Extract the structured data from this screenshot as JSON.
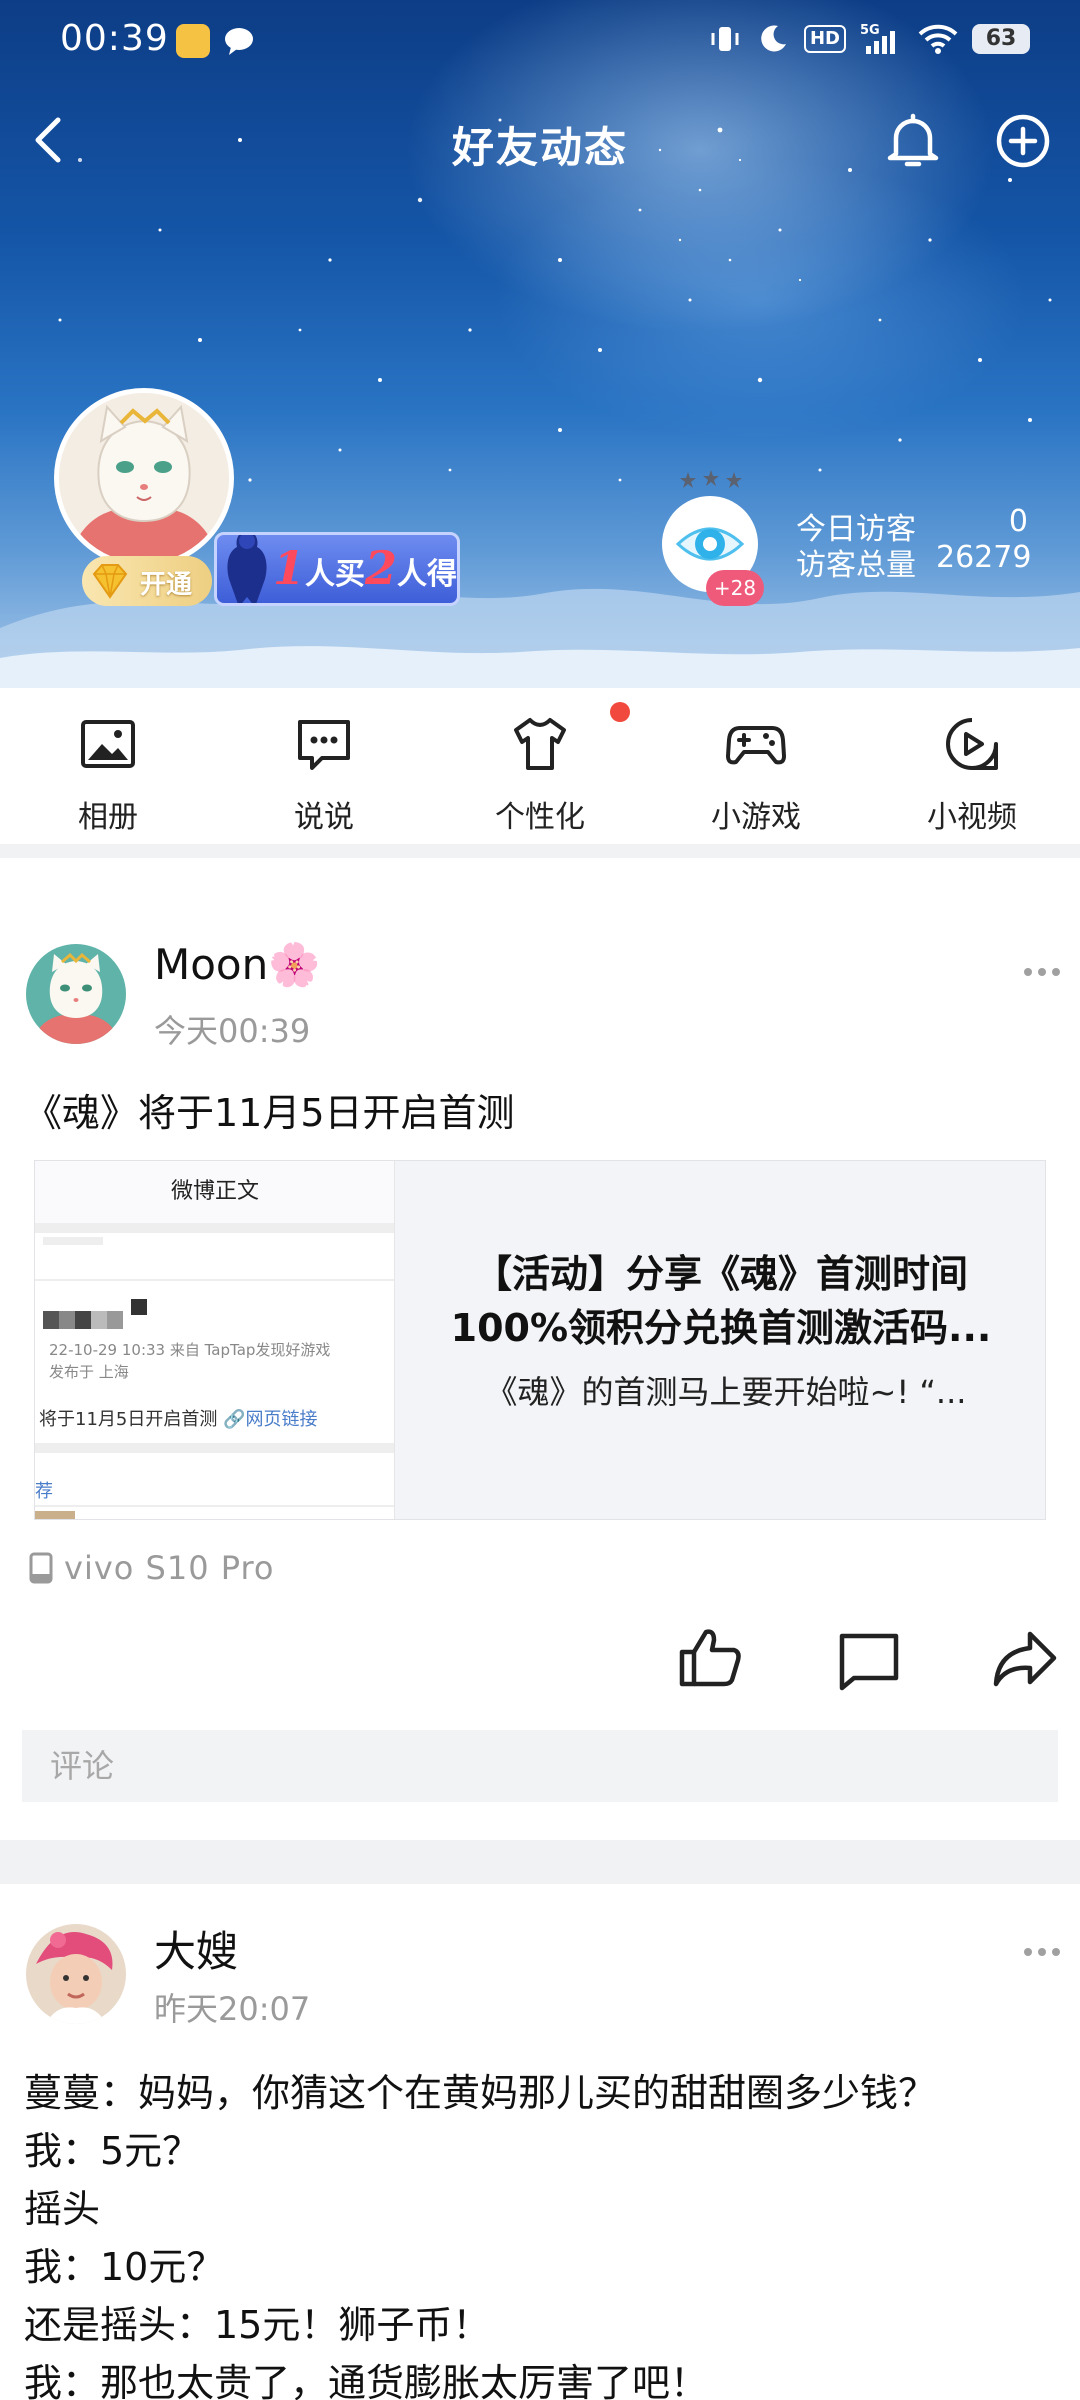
{
  "status_bar": {
    "time": "00:39",
    "battery": "63",
    "network": "5G",
    "hd": "HD"
  },
  "header": {
    "title": "好友动态"
  },
  "profile": {
    "vip_label": "开通",
    "promo": {
      "n1": "1",
      "t1": "人买",
      "n2": "2",
      "t2": "人得"
    },
    "visitor_badge": "+28",
    "today_visitors_label": "今日访客",
    "today_visitors_value": "0",
    "total_visitors_label": "访客总量",
    "total_visitors_value": "26279"
  },
  "nav": {
    "items": [
      {
        "label": "相册",
        "icon": "photo-album-icon"
      },
      {
        "label": "说说",
        "icon": "message-icon"
      },
      {
        "label": "个性化",
        "icon": "shirt-icon"
      },
      {
        "label": "小游戏",
        "icon": "gamepad-icon"
      },
      {
        "label": "小视频",
        "icon": "play-video-icon"
      }
    ]
  },
  "posts": [
    {
      "author": "Moon🌸",
      "time": "今天00:39",
      "text": "《魂》将于11月5日开启首测",
      "card": {
        "thumb_header": "微博正文",
        "thumb_meta_1": "22-10-29 10:33  来自 TapTap发现好游戏",
        "thumb_meta_2": "发布于 上海",
        "thumb_link_text": "将于11月5日开启首测",
        "thumb_link_label": "网页链接",
        "thumb_tag": "荐",
        "title_line1": "【活动】分享《魂》首测时间",
        "title_line2": "100%领积分兑换首测激活码...",
        "desc": "《魂》的首测马上要开始啦~!     “..."
      },
      "device": "vivo  S10  Pro",
      "comment_placeholder": "评论"
    },
    {
      "author": "大嫂",
      "time": "昨天20:07",
      "lines": [
        "蔓蔓：妈妈，你猜这个在黄妈那儿买的甜甜圈多少钱？",
        "我：5元？",
        "摇头",
        "我：10元？",
        "还是摇头：15元！狮子币！",
        "我：那也太贵了，通货膨胀太厉害了吧！"
      ]
    }
  ],
  "colors": {
    "accent_red": "#f2493e",
    "muted_text": "#9a9a9a",
    "hero_blue": "#1556a8"
  }
}
